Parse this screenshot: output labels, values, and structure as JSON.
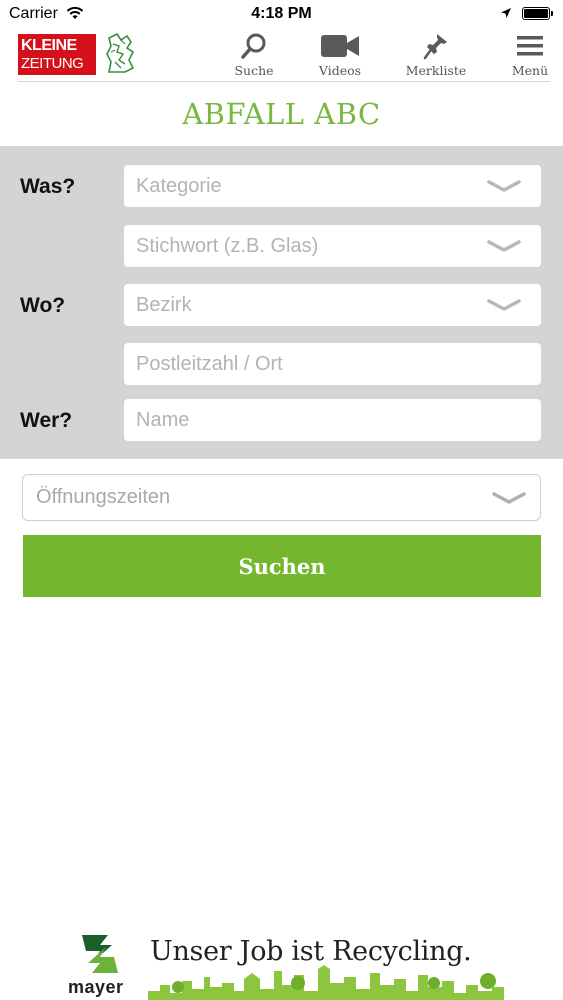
{
  "status_bar": {
    "carrier": "Carrier",
    "time": "4:18 PM"
  },
  "header": {
    "logo_line1": "KLEINE",
    "logo_line2": "ZEITUNG",
    "logo_color": "#d4111a",
    "nav": [
      {
        "label": "Suche",
        "icon": "search-icon"
      },
      {
        "label": "Videos",
        "icon": "video-camera-icon"
      },
      {
        "label": "Merkliste",
        "icon": "pushpin-icon"
      },
      {
        "label": "Menü",
        "icon": "hamburger-menu-icon"
      }
    ]
  },
  "page": {
    "title": "ABFALL ABC",
    "accent_color": "#78b842"
  },
  "form": {
    "labels": {
      "was": "Was?",
      "wo": "Wo?",
      "wer": "Wer?"
    },
    "kategorie_placeholder": "Kategorie",
    "stichwort_placeholder": "Stichwort (z.B. Glas)",
    "bezirk_placeholder": "Bezirk",
    "plz_placeholder": "Postleitzahl / Ort",
    "name_placeholder": "Name",
    "oeffnungszeiten_placeholder": "Öffnungszeiten",
    "submit_label": "Suchen",
    "button_color": "#74b72e",
    "panel_color": "#d4d4d4"
  },
  "ad": {
    "brand": "mayer",
    "slogan": "Unser Job ist Recycling."
  }
}
